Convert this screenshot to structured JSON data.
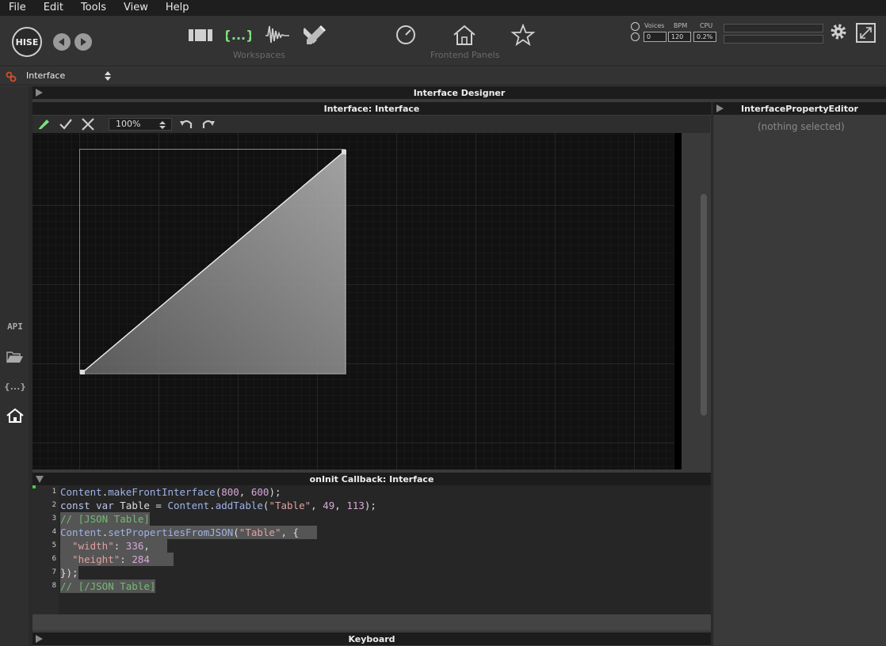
{
  "menu": [
    "File",
    "Edit",
    "Tools",
    "View",
    "Help"
  ],
  "toolbar": {
    "logo": "HISE",
    "workspaces_caption": "Workspaces",
    "frontend_caption": "Frontend Panels",
    "stats": {
      "voices_label": "Voices",
      "bpm_label": "BPM",
      "cpu_label": "CPU",
      "voices": "0",
      "bpm": "120",
      "cpu": "0.2%"
    }
  },
  "subbar": {
    "selector": "Interface"
  },
  "leftstrip": {
    "api": "API",
    "code": "{...}"
  },
  "panels": {
    "designer": "Interface Designer",
    "interface": "Interface: Interface",
    "property_editor": "InterfacePropertyEditor",
    "nothing_selected": "(nothing selected)",
    "oninit": "onInit Callback: Interface",
    "keyboard": "Keyboard"
  },
  "designer": {
    "zoom": "100%"
  },
  "code": {
    "line_numbers": [
      "1",
      "2",
      "3",
      "4",
      "5",
      "6",
      "7",
      "8"
    ],
    "l1": {
      "a": "Content",
      "b": ".",
      "c": "makeFrontInterface",
      "d": "(",
      "e": "800",
      "f": ", ",
      "g": "600",
      "h": ");"
    },
    "l2": {
      "a": "const var ",
      "b": "Table",
      "c": " = ",
      "d": "Content",
      "e": ".",
      "f": "addTable",
      "g": "(",
      "h": "\"Table\"",
      "i": ", ",
      "j": "49",
      "k": ", ",
      "l": "113",
      "m": ");"
    },
    "l3": "// [JSON Table]",
    "l4": {
      "a": "Content",
      "b": ".",
      "c": "setPropertiesFromJSON",
      "d": "(",
      "e": "\"Table\"",
      "f": ", {"
    },
    "l5": {
      "a": "  \"width\"",
      "b": ": ",
      "c": "336",
      "d": ","
    },
    "l6": {
      "a": "  \"height\"",
      "b": ": ",
      "c": "284"
    },
    "l7": "});",
    "l8": "// [/JSON Table]"
  },
  "table_component": {
    "width": 336,
    "height": 284
  }
}
